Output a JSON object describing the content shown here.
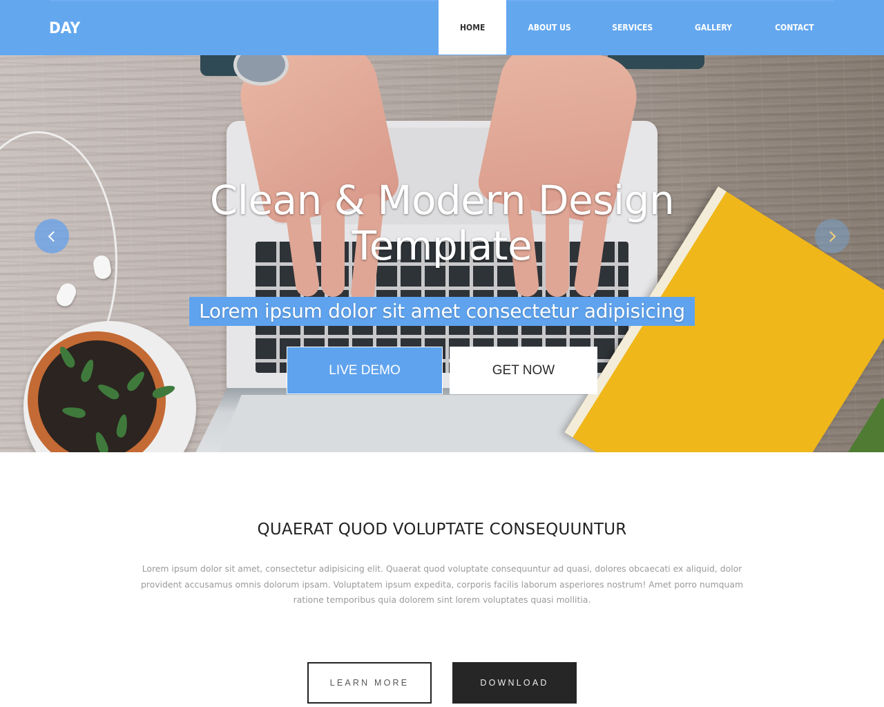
{
  "header": {
    "brand": "DAY",
    "nav": [
      {
        "label": "HOME",
        "active": true
      },
      {
        "label": "ABOUT US",
        "active": false
      },
      {
        "label": "SERVICES",
        "active": false
      },
      {
        "label": "GALLERY",
        "active": false
      },
      {
        "label": "CONTACT",
        "active": false
      }
    ]
  },
  "hero": {
    "title_line1": "Clean & Modern Design",
    "title_line2": "Template",
    "subtitle": "Lorem ipsum dolor sit amet consectetur adipisicing",
    "primary_button": "LIVE DEMO",
    "secondary_button": "GET NOW",
    "prev_icon": "chevron-left-icon",
    "next_icon": "chevron-right-icon",
    "background_image": "desk-with-laptop-hands-plant-book"
  },
  "about": {
    "heading": "QUAERAT QUOD VOLUPTATE CONSEQUUNTUR",
    "text": "Lorem ipsum dolor sit amet, consectetur adipisicing elit. Quaerat quod voluptate consequuntur ad quasi, dolores obcaecati ex aliquid, dolor provident accusamus omnis dolorum ipsam. Voluptatem ipsum expedita, corporis facilis laborum asperiores nostrum! Amet porro numquam ratione temporibus quia dolorem sint lorem voluptates quasi mollitia.",
    "learn_more": "LEARN MORE",
    "download": "DOWNLOAD"
  },
  "colors": {
    "accent": "#63a7ef",
    "dark_button": "#262626",
    "heading": "#222222",
    "body_text": "#9a9a9a"
  }
}
